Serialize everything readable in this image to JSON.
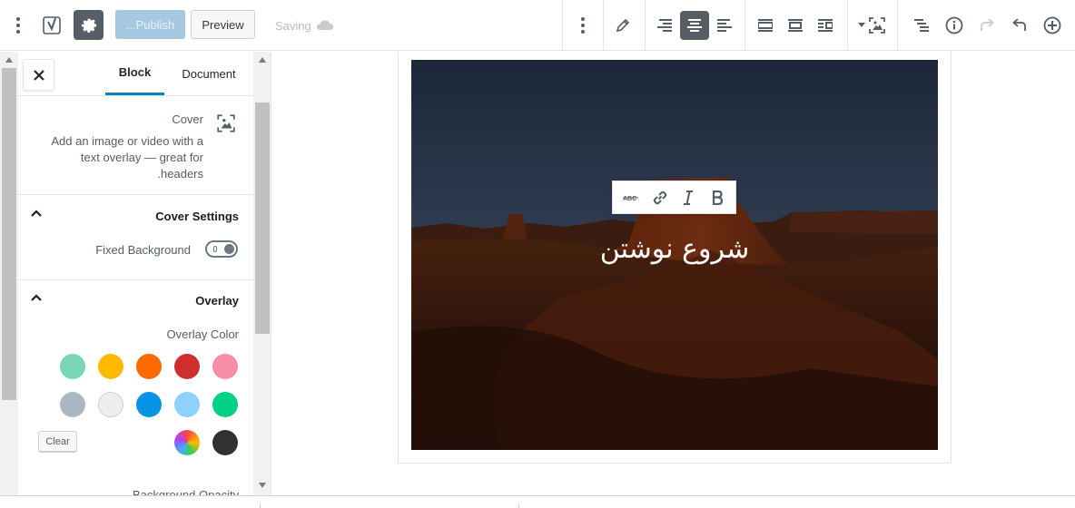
{
  "toolbar": {
    "publish_label": "...Publish",
    "preview_label": "Preview",
    "saving_label": "Saving",
    "icons": [
      "more-vertical-icon",
      "yoast-icon",
      "gear-icon",
      "pencil-icon",
      "align-right-icon",
      "align-center-icon",
      "align-left-icon",
      "wide-width-icon",
      "full-width-icon",
      "align-image-icon",
      "cover-image-icon",
      "block-navigation-icon",
      "info-icon",
      "redo-icon",
      "undo-icon",
      "add-block-icon"
    ]
  },
  "sidebar": {
    "tabs": {
      "block": "Block",
      "document": "Document"
    },
    "block_card": {
      "title": "Cover",
      "description": "Add an image or video with a text overlay — great for .headers"
    },
    "cover_settings": {
      "title": "Cover Settings",
      "fixed_background_label": "Fixed Background",
      "fixed_background_on": true
    },
    "overlay": {
      "title": "Overlay",
      "overlay_color_label": "Overlay Color",
      "swatches": [
        "#79d6b5",
        "#fcb900",
        "#ff6900",
        "#cf2e2e",
        "#f78da7",
        "#abb8c3",
        "#eeeeee",
        "#0693e3",
        "#8ed1fc",
        "#00d084",
        "gradient",
        "#313131"
      ],
      "clear_label": "Clear",
      "background_opacity_label": "Background Opacity"
    }
  },
  "editor": {
    "cover_text": "شروع نوشتن",
    "format_toolbar": [
      "strikethrough-icon",
      "link-icon",
      "italic-icon",
      "bold-icon"
    ]
  },
  "colors": {
    "accent": "#0085ba",
    "publish_bg": "#a6c8e0",
    "active_tool": "#555d66"
  }
}
